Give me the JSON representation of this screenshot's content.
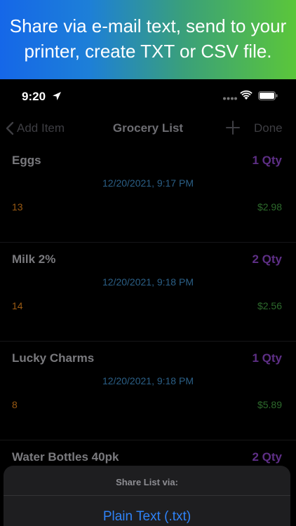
{
  "banner": {
    "line1": "Share via e-mail text, send to your",
    "line2": "printer, create TXT or CSV file."
  },
  "status_bar": {
    "time": "9:20",
    "icons": [
      "location-arrow-icon",
      "signal-dots-icon",
      "wifi-icon",
      "battery-icon"
    ]
  },
  "nav": {
    "back_label": "Add Item",
    "title": "Grocery List",
    "add_icon": "plus-icon",
    "done_label": "Done"
  },
  "items": [
    {
      "name": "Eggs",
      "qty": "1 Qty",
      "date": "12/20/2021, 9:17 PM",
      "number": "13",
      "price": "$2.98"
    },
    {
      "name": "Milk 2%",
      "qty": "2 Qty",
      "date": "12/20/2021, 9:18 PM",
      "number": "14",
      "price": "$2.56"
    },
    {
      "name": "Lucky Charms",
      "qty": "1 Qty",
      "date": "12/20/2021, 9:18 PM",
      "number": "8",
      "price": "$5.89"
    },
    {
      "name": "Water Bottles 40pk",
      "qty": "2 Qty",
      "date": "",
      "number": "",
      "price": ""
    }
  ],
  "share_sheet": {
    "heading": "Share List via:",
    "options": [
      "Plain Text (.txt)"
    ]
  },
  "colors": {
    "qty": "#5e2f86",
    "date": "#2b5f86",
    "number": "#9a5a13",
    "price": "#2d6a2c",
    "action": "#2f82f6"
  }
}
